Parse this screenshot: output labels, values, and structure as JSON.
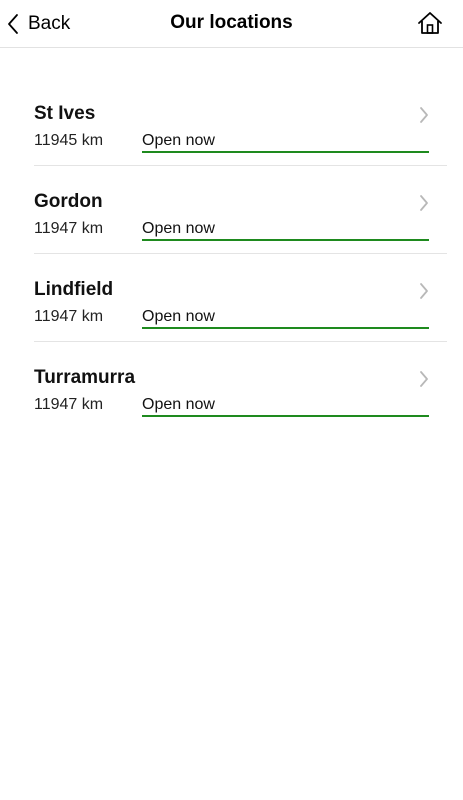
{
  "nav": {
    "back_label": "Back",
    "title": "Our locations",
    "home_icon": "home-icon",
    "back_icon": "chevron-left-icon"
  },
  "colors": {
    "status_underline": "#1e8a1e",
    "divider": "#e4e4e4"
  },
  "locations": [
    {
      "name": "St Ives",
      "distance": "11945 km",
      "status": "Open now"
    },
    {
      "name": "Gordon",
      "distance": "11947 km",
      "status": "Open now"
    },
    {
      "name": "Lindfield",
      "distance": "11947 km",
      "status": "Open now"
    },
    {
      "name": "Turramurra",
      "distance": "11947 km",
      "status": "Open now"
    }
  ]
}
